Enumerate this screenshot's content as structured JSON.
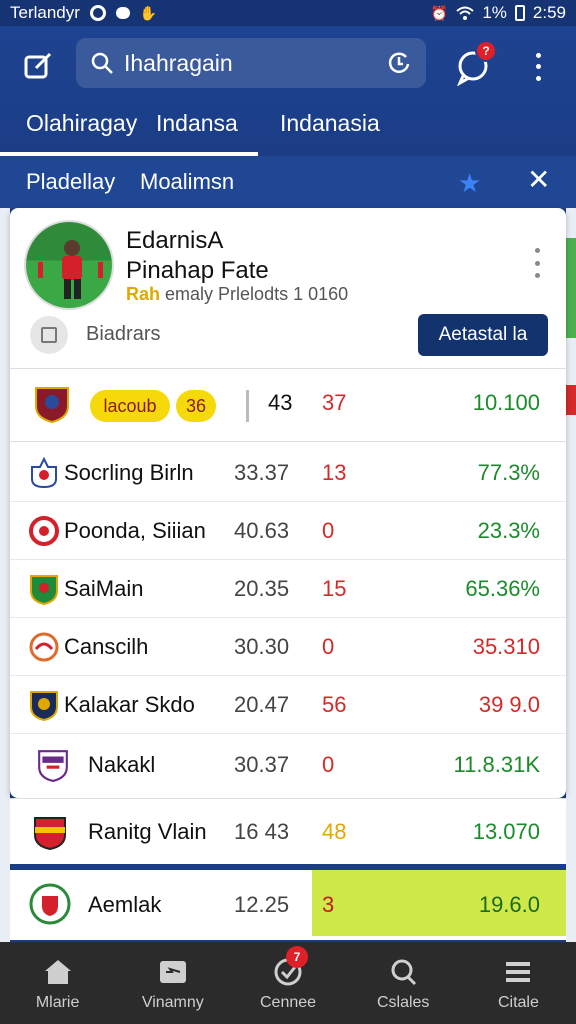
{
  "status_bar": {
    "carrier": "Terlandyr",
    "signal_text": "1%",
    "time": "2:59"
  },
  "header": {
    "search": {
      "value": "",
      "placeholder": "Ihahragain"
    },
    "notification_count": "?",
    "tabs": [
      {
        "label": "Olahiragay",
        "active": true
      },
      {
        "label": "Indansa"
      },
      {
        "label": "Indanasia"
      }
    ]
  },
  "sub_bar": {
    "items": [
      "Pladellay",
      "Moalimsn"
    ]
  },
  "player": {
    "name_line1": "EdarnisA",
    "name_line2": "Pinahap Fate",
    "tag": "Rah",
    "meta": "emaly Prlelodts 1 0160",
    "bio_label": "Biadrars",
    "action_label": "Aetastal la"
  },
  "highlight_row": {
    "pill_left": "lacoub",
    "pill_right": "36",
    "val_a": "43",
    "val_b": "37",
    "val_c": "10.100"
  },
  "rows": [
    {
      "team": "Socrling Birln",
      "a": "33.37",
      "b": "13",
      "c": "77.3%",
      "c_color": "green",
      "crest": "crest-blue-white"
    },
    {
      "team": "Poonda, Siiian",
      "a": "40.63",
      "b": "0",
      "c": "23.3%",
      "c_color": "green",
      "crest": "crest-red-ring"
    },
    {
      "team": "SaiMain",
      "a": "20.35",
      "b": "15",
      "c": "65.36%",
      "c_color": "green",
      "crest": "crest-green-shield"
    },
    {
      "team": "Canscilh",
      "a": "30.30",
      "b": "0",
      "c": "35.310",
      "c_color": "red",
      "crest": "crest-orange-ring"
    },
    {
      "team": "Kalakar Skdo",
      "a": "20.47",
      "b": "56",
      "c": "39 9.0",
      "c_color": "red",
      "crest": "crest-navy-shield"
    },
    {
      "team": "Nakakl",
      "a": "30.37",
      "b": "0",
      "c": "11.8.31K",
      "c_color": "green",
      "crest": "crest-purple-shield"
    }
  ],
  "loose_rows": [
    {
      "team": "Ranitg Vlain",
      "a": "16 43",
      "b": "48",
      "c": "13.070",
      "crest": "crest-red-yellow"
    },
    {
      "team": "Aemlak",
      "a": "12.25",
      "b": "3",
      "c": "19.6.0",
      "crest": "crest-green-wreath"
    }
  ],
  "bottom_nav": {
    "items": [
      {
        "label": "Mlarie",
        "icon": "home-icon"
      },
      {
        "label": "Vinamny",
        "icon": "tv-icon"
      },
      {
        "label": "Cennee",
        "icon": "check-badge-icon"
      },
      {
        "label": "Cslales",
        "icon": "search-icon"
      },
      {
        "label": "Citale",
        "icon": "menu-icon"
      }
    ],
    "badge": "7"
  },
  "colors": {
    "header_bg": "#1b3d86",
    "positive": "#1a8c2a",
    "negative": "#d42a2a",
    "highlight": "#cfe84a",
    "pill": "#f5d90a"
  }
}
